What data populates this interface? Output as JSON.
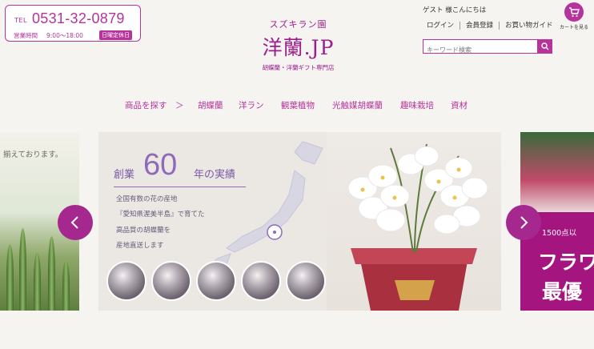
{
  "header": {
    "tel_label": "TEL",
    "tel_number": "0531-32-0879",
    "hours_label": "営業時間",
    "hours_time": "9:00～18:00",
    "holiday": "日曜定休日",
    "logo_sub": "スズキラン園",
    "logo_main": "洋蘭.JP",
    "logo_tag": "胡蝶蘭・洋蘭ギフト専門店",
    "greeting": "ゲスト 様こんにちは",
    "links": [
      "ログイン",
      "会員登録",
      "お買い物ガイド"
    ],
    "cart_label": "カートを見る",
    "search_placeholder": "キーワード検索"
  },
  "nav": {
    "items": [
      "商品を探す",
      "＞",
      "胡蝶蘭",
      "洋ラン",
      "観葉植物",
      "光触媒胡蝶蘭",
      "趣味栽培",
      "資材"
    ]
  },
  "hero": {
    "left_caption": "揃えております。",
    "title_prefix": "創業",
    "title_number": "60",
    "title_suffix": "年の実績",
    "desc": [
      "全国有数の花の産地",
      "『愛知県渥美半島』で育てた",
      "高品質の胡蝶蘭を",
      "産地直送します"
    ],
    "right_count": "1500点以",
    "right_big1": "フラワ",
    "right_big2": "最優"
  },
  "colors": {
    "brand": "#b5339b",
    "arrow": "#a5288f"
  }
}
